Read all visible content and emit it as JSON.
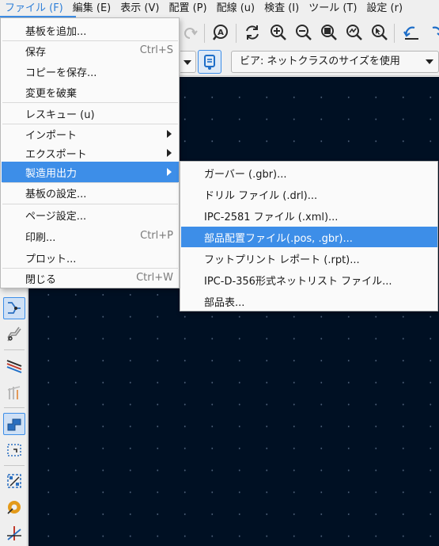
{
  "menubar": {
    "items": [
      "ファイル (F)",
      "編集 (E)",
      "表示 (V)",
      "配置 (P)",
      "配線 (u)",
      "検査 (I)",
      "ツール (T)",
      "設定 (r)"
    ]
  },
  "toolbar": {
    "icons": [
      "undo-icon",
      "redo-icon",
      "find-icon",
      "refresh-icon",
      "zoom-in-icon",
      "zoom-out-icon",
      "zoom-fit-icon",
      "zoom-objects-icon",
      "zoom-selection-icon",
      "rotate-ccw-icon",
      "rotate-cw-icon"
    ]
  },
  "toolbar2": {
    "via_combo_label": "ビア: ネットクラスのサイズを使用"
  },
  "file_menu": {
    "items": [
      {
        "label": "基板を追加...",
        "shortcut": ""
      },
      {
        "label": "保存",
        "shortcut": "Ctrl+S"
      },
      {
        "label": "コピーを保存...",
        "shortcut": ""
      },
      {
        "label": "変更を破棄",
        "shortcut": ""
      },
      {
        "label": "レスキュー (u)",
        "shortcut": ""
      },
      {
        "label": "インポート",
        "shortcut": ""
      },
      {
        "label": "エクスポート",
        "shortcut": ""
      },
      {
        "label": "製造用出力",
        "shortcut": ""
      },
      {
        "label": "基板の設定...",
        "shortcut": ""
      },
      {
        "label": "ページ設定...",
        "shortcut": ""
      },
      {
        "label": "印刷...",
        "shortcut": "Ctrl+P"
      },
      {
        "label": "プロット...",
        "shortcut": ""
      },
      {
        "label": "閉じる",
        "shortcut": "Ctrl+W"
      }
    ]
  },
  "fab_submenu": {
    "items": [
      {
        "label": "ガーバー (.gbr)..."
      },
      {
        "label": "ドリル ファイル (.drl)..."
      },
      {
        "label": "IPC-2581 ファイル (.xml)..."
      },
      {
        "label": "部品配置ファイル(.pos, .gbr)..."
      },
      {
        "label": "フットプリント レポート (.rpt)..."
      },
      {
        "label": "IPC-D-356形式ネットリスト ファイル..."
      },
      {
        "label": "部品表..."
      }
    ]
  },
  "left_toolbar": {
    "icons": [
      "select-icon",
      "route-track-icon",
      "route-diff-pair-icon",
      "tune-length-icon",
      "tune-skew-icon",
      "add-zone-icon",
      "add-rule-area-icon",
      "add-via-icon",
      "add-pad-icon",
      "microwave-icon",
      "add-line-icon"
    ]
  },
  "colors": {
    "accent": "#3d8ee8",
    "canvas_background": "#001023",
    "menu_background": "#fafafa"
  }
}
